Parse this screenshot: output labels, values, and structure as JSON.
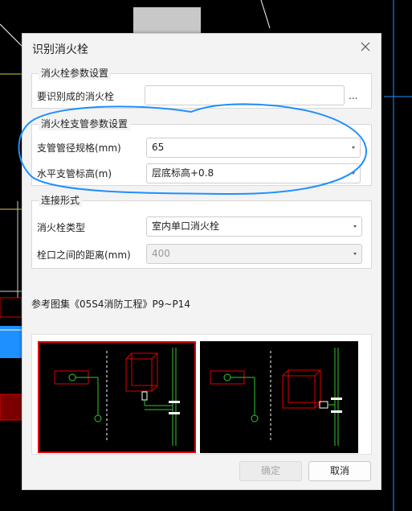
{
  "dialog": {
    "title": "识别消火栓",
    "close_icon": "close-icon"
  },
  "group_hydrant": {
    "title": "消火栓参数设置",
    "fields": {
      "identified_label": "要识别成的消火栓",
      "identified_value": "",
      "browse_label": "..."
    }
  },
  "group_branch": {
    "title": "消火栓支管参数设置",
    "pipe_size_label": "支管管径规格(mm)",
    "pipe_size_value": "65",
    "elevation_label": "水平支管标高(m)",
    "elevation_value": "层底标高+0.8"
  },
  "group_connection": {
    "title": "连接形式",
    "type_label": "消火栓类型",
    "type_value": "室内单口消火栓",
    "distance_label": "栓口之间的距离(mm)",
    "distance_value": "400"
  },
  "reference_text": "参考图集《05S4消防工程》P9~P14",
  "buttons": {
    "ok_label": "确定",
    "cancel_label": "取消"
  },
  "colors": {
    "annotation_circle": "#1e90ff",
    "selected_thumbnail_border": "#e00000",
    "cad_red": "#e00000",
    "cad_green": "#32c832"
  }
}
